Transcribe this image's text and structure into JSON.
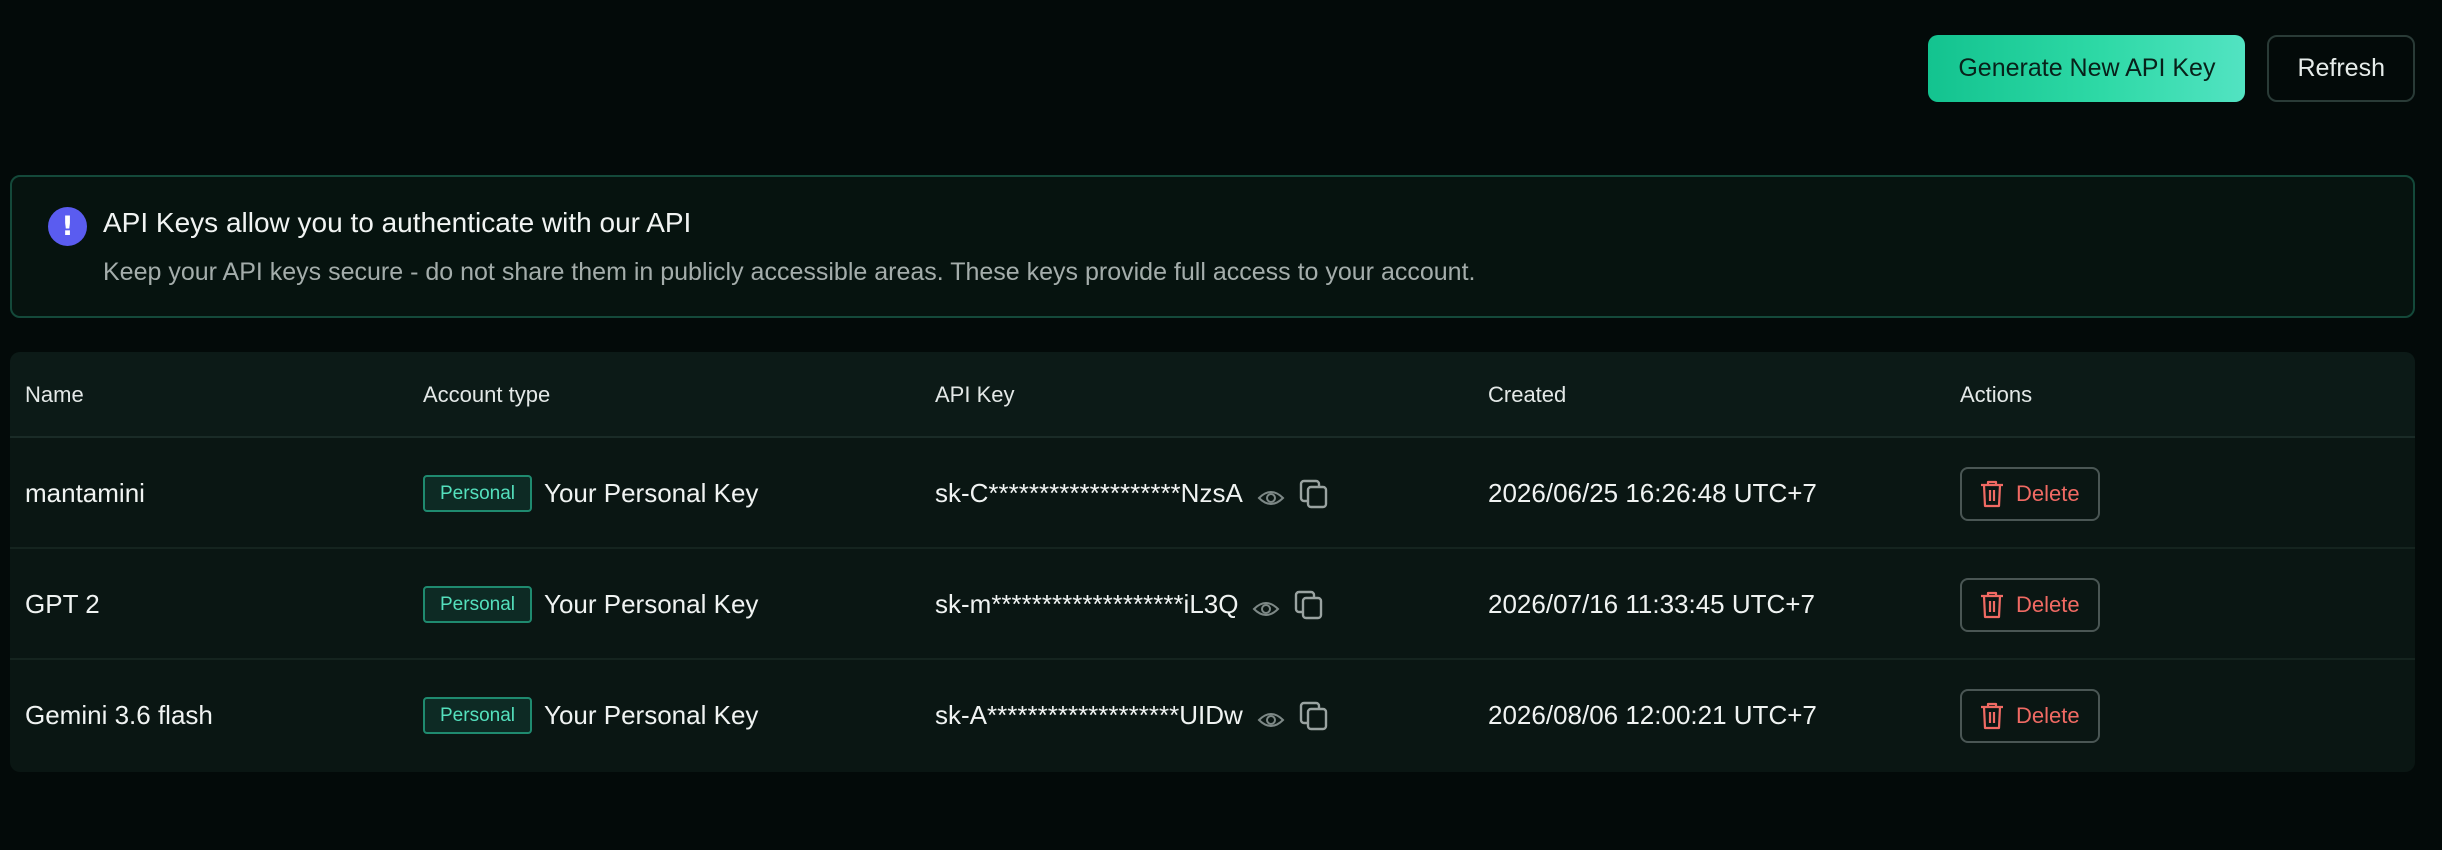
{
  "toolbar": {
    "generate_label": "Generate New API Key",
    "refresh_label": "Refresh"
  },
  "banner": {
    "icon": "exclamation-icon",
    "title": "API Keys allow you to authenticate with our API",
    "description": "Keep your API keys secure - do not share them in publicly accessible areas. These keys provide full access to your account."
  },
  "table": {
    "headers": [
      "Name",
      "Account type",
      "API Key",
      "Created",
      "Actions"
    ],
    "rows": [
      {
        "name": "mantamini",
        "account_badge": "Personal",
        "account_label": "Your Personal Key",
        "api_key": "sk-C*******************NzsA",
        "created": "2026/06/25 16:26:48 UTC+7",
        "action": "Delete"
      },
      {
        "name": "GPT 2",
        "account_badge": "Personal",
        "account_label": "Your Personal Key",
        "api_key": "sk-m*******************iL3Q",
        "created": "2026/07/16 11:33:45 UTC+7",
        "action": "Delete"
      },
      {
        "name": "Gemini 3.6 flash",
        "account_badge": "Personal",
        "account_label": "Your Personal Key",
        "api_key": "sk-A*******************UIDw",
        "created": "2026/08/06 12:00:21 UTC+7",
        "action": "Delete"
      }
    ]
  },
  "colors": {
    "background": "#030a09",
    "accent": "#2ed9a6",
    "info_icon": "#5a5cf0",
    "danger": "#f06a63",
    "badge_text": "#54e0bd"
  }
}
